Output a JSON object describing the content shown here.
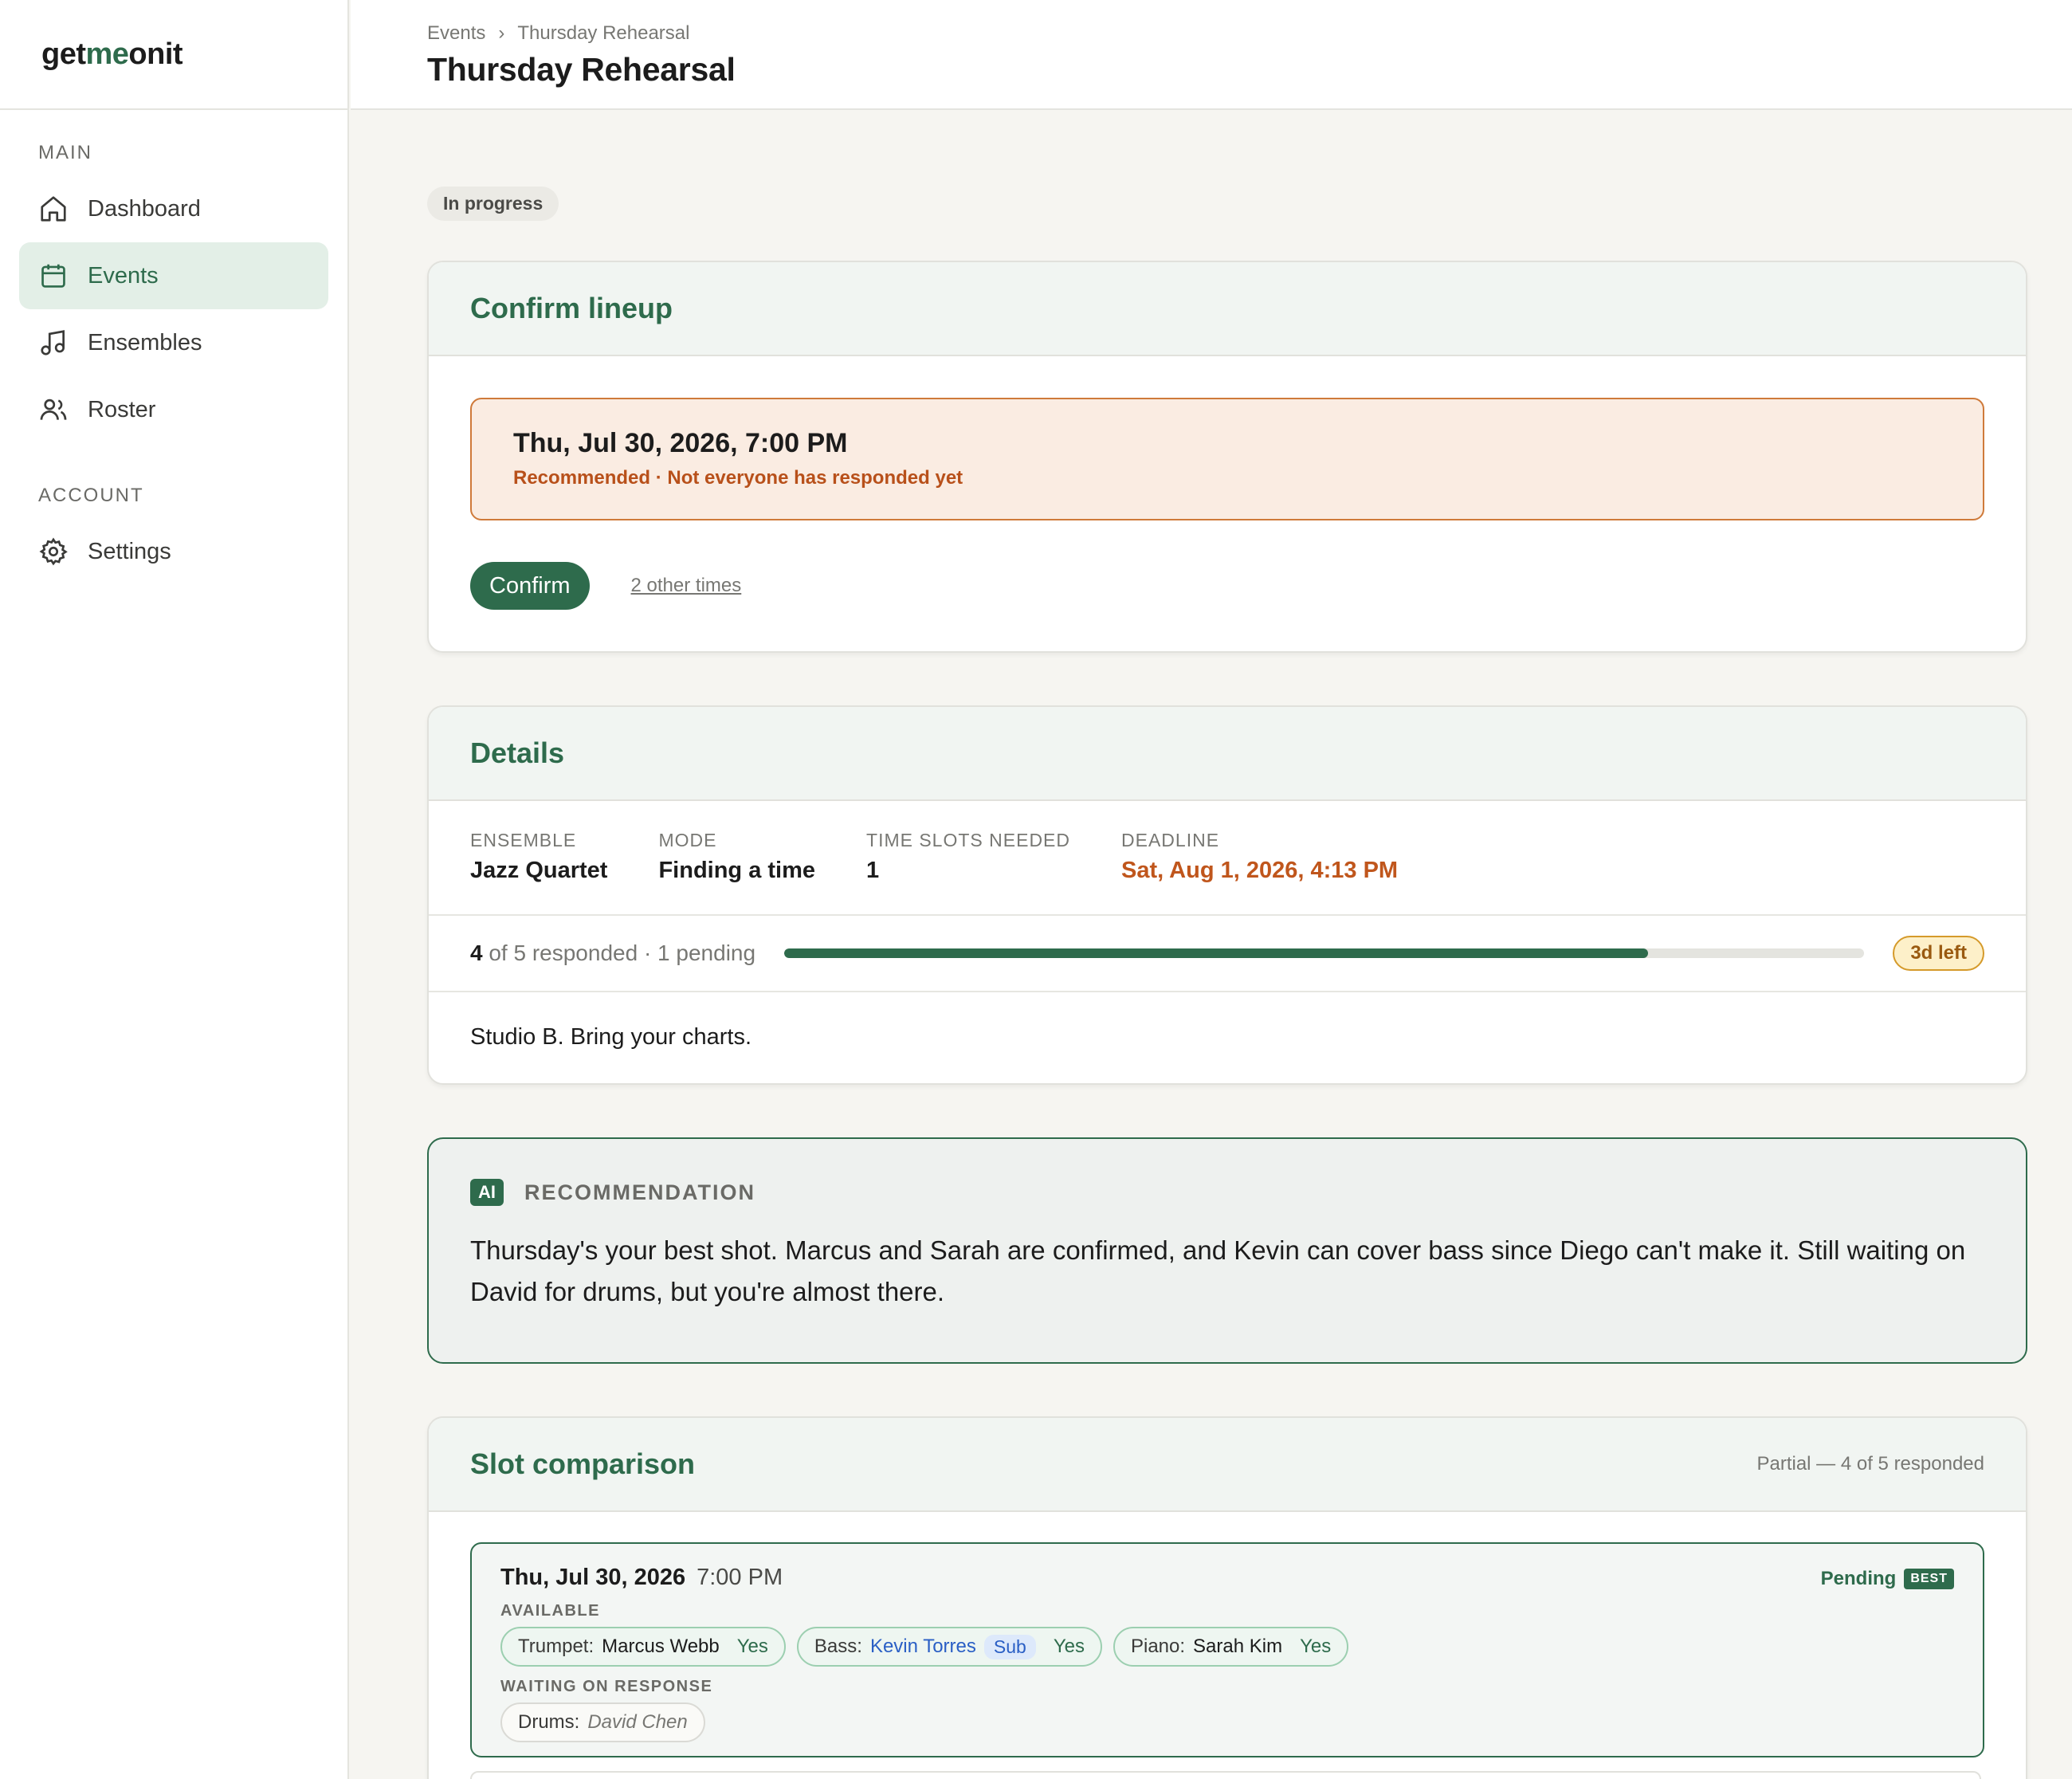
{
  "brand": {
    "pre": "get",
    "accent": "me",
    "post": "onit"
  },
  "sidebar": {
    "main_heading": "MAIN",
    "account_heading": "ACCOUNT",
    "items": [
      {
        "label": "Dashboard",
        "icon": "home-icon"
      },
      {
        "label": "Events",
        "icon": "calendar-icon",
        "active": true
      },
      {
        "label": "Ensembles",
        "icon": "music-note-icon"
      },
      {
        "label": "Roster",
        "icon": "users-icon"
      },
      {
        "label": "Settings",
        "icon": "gear-icon"
      }
    ]
  },
  "header": {
    "breadcrumb": [
      "Events",
      "Thursday Rehearsal"
    ],
    "separator": "›",
    "title": "Thursday Rehearsal"
  },
  "status": "In progress",
  "confirm_card": {
    "title": "Confirm lineup",
    "recommended_date": "Thu, Jul 30, 2026, 7:00 PM",
    "recommended_note": "Recommended · Not everyone has responded yet",
    "confirm_label": "Confirm",
    "other_times_label": "2 other times"
  },
  "details_card": {
    "title": "Details",
    "fields": [
      {
        "label": "ENSEMBLE",
        "value": "Jazz Quartet"
      },
      {
        "label": "MODE",
        "value": "Finding a time"
      },
      {
        "label": "TIME SLOTS NEEDED",
        "value": "1"
      },
      {
        "label": "DEADLINE",
        "value": "Sat, Aug 1, 2026, 4:13 PM"
      }
    ],
    "responded": "4",
    "responded_rest": " of 5 responded · 1 pending",
    "progress_fraction": 0.8,
    "time_left": "3d left",
    "notes": "Studio B. Bring your charts."
  },
  "ai_card": {
    "badge": "AI",
    "label": "RECOMMENDATION",
    "text": "Thursday's your best shot. Marcus and Sarah are confirmed, and Kevin can cover bass since Diego can't make it. Still waiting on David for drums, but you're almost there."
  },
  "slots_card": {
    "title": "Slot comparison",
    "meta": "Partial — 4 of 5 responded",
    "slot": {
      "date": "Thu, Jul 30, 2026",
      "time": "7:00 PM",
      "status": "Pending",
      "best_tag": "BEST",
      "available_label": "AVAILABLE",
      "waiting_label": "WAITING ON RESPONSE",
      "available": [
        {
          "role": "Trumpet:",
          "name": "Marcus Webb",
          "answer": "Yes"
        },
        {
          "role": "Bass:",
          "name": "Kevin Torres",
          "sub": "Sub",
          "answer": "Yes"
        },
        {
          "role": "Piano:",
          "name": "Sarah Kim",
          "answer": "Yes"
        }
      ],
      "waiting": [
        {
          "role": "Drums:",
          "name": "David Chen"
        }
      ]
    }
  },
  "colors": {
    "accent": "#2e6b4c",
    "warning": "#c0561c",
    "background": "#f6f5f1"
  }
}
